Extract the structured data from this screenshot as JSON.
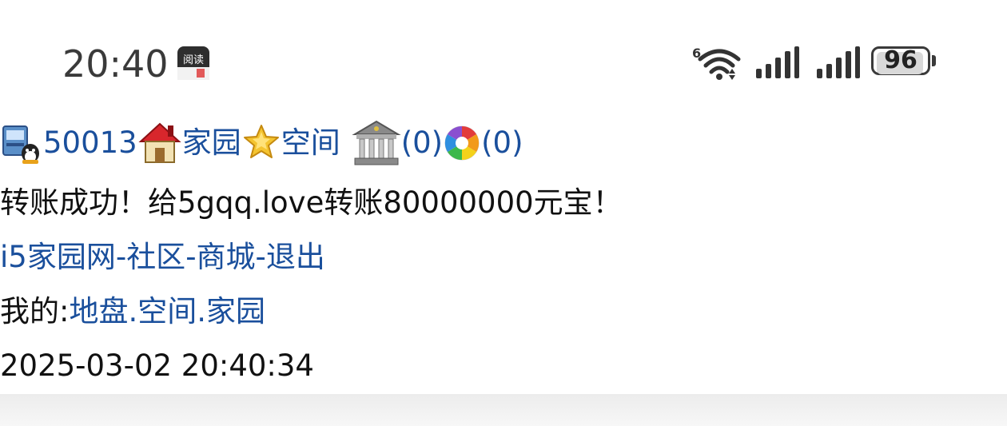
{
  "status_bar": {
    "time": "20:40",
    "app_icon_label": "阅读",
    "wifi_badge": "6",
    "battery_percent": "96",
    "battery_level": 0.96
  },
  "nav": {
    "user_id": "50013",
    "home_label": "家园",
    "space_label": "空间",
    "bank_count": "(0)",
    "photo_count": "(0)"
  },
  "message": "转账成功！给5gqq.love转账80000000元宝！",
  "links": {
    "site": "i5家园网",
    "sep1": "-",
    "community": "社区",
    "sep2": "-",
    "mall": "商城",
    "sep3": "-",
    "logout": "退出"
  },
  "mine": {
    "prefix": "我的:",
    "territory": "地盘",
    "dot1": ".",
    "space": "空间",
    "dot2": ".",
    "home": "家园"
  },
  "timestamp": "2025-03-02 20:40:34"
}
